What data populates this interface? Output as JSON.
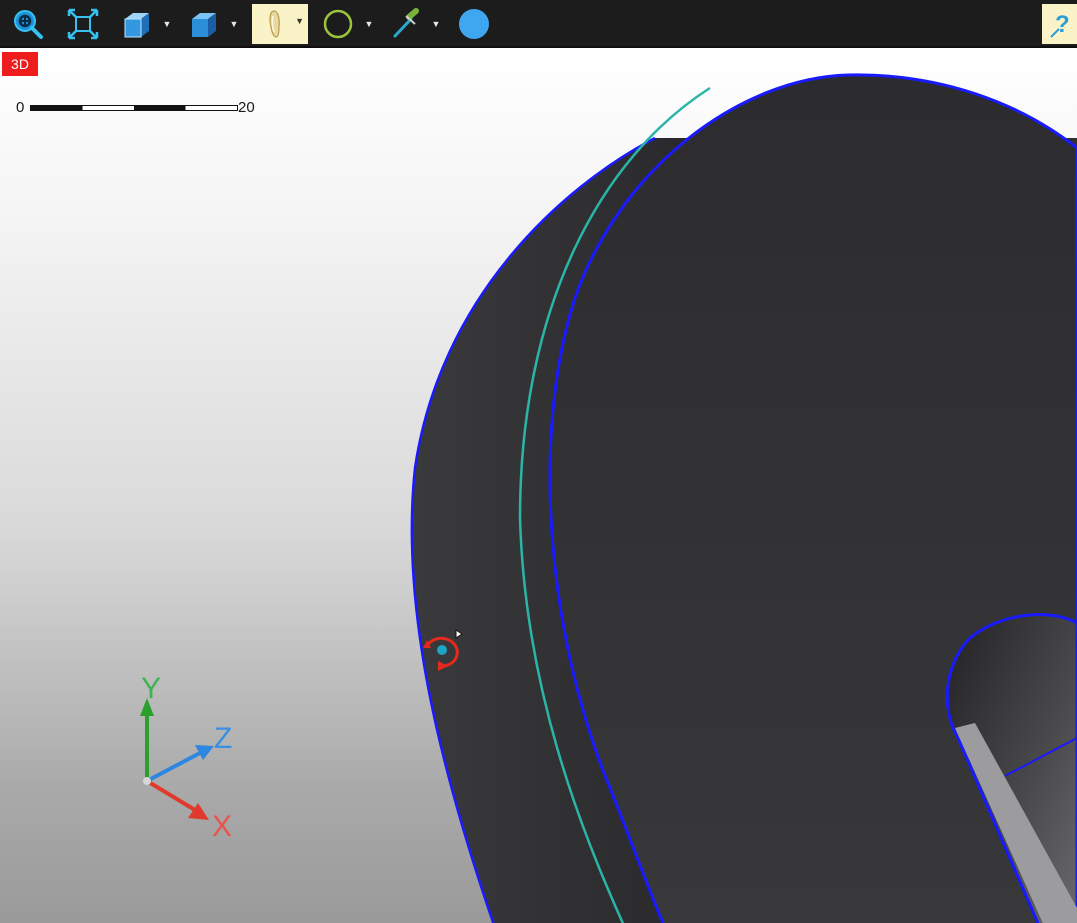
{
  "toolbar": {
    "buttons": [
      {
        "id": "zoom",
        "icon": "zoom-magnifier-icon",
        "dropdown": false
      },
      {
        "id": "zoom-extents",
        "icon": "zoom-extents-icon",
        "dropdown": false
      },
      {
        "id": "view-cube",
        "icon": "isometric-view-cube-icon",
        "dropdown": true
      },
      {
        "id": "visual-style",
        "icon": "shaded-cube-icon",
        "dropdown": true
      },
      {
        "id": "rendering",
        "icon": "rendering-bulb-icon",
        "dropdown": true,
        "active": true
      },
      {
        "id": "circle-tool",
        "icon": "circle-icon",
        "dropdown": true
      },
      {
        "id": "color-picker",
        "icon": "eyedropper-icon",
        "dropdown": true
      },
      {
        "id": "color-swatch",
        "icon": "blue-dot-icon",
        "dropdown": false
      },
      {
        "id": "help",
        "icon": "help-question-icon",
        "dropdown": false
      }
    ]
  },
  "viewport": {
    "mode_badge": "3D",
    "scale_bar": {
      "min_label": "0",
      "max_label": "20"
    },
    "ucs": {
      "y_label": "Y",
      "z_label": "Z",
      "x_label": "X"
    },
    "colors": {
      "model_face": "#2e2e30",
      "edge_highlight": "#1a1aff",
      "rim_edge": "#2bb5a8",
      "badge": "#ee1c1c"
    }
  }
}
